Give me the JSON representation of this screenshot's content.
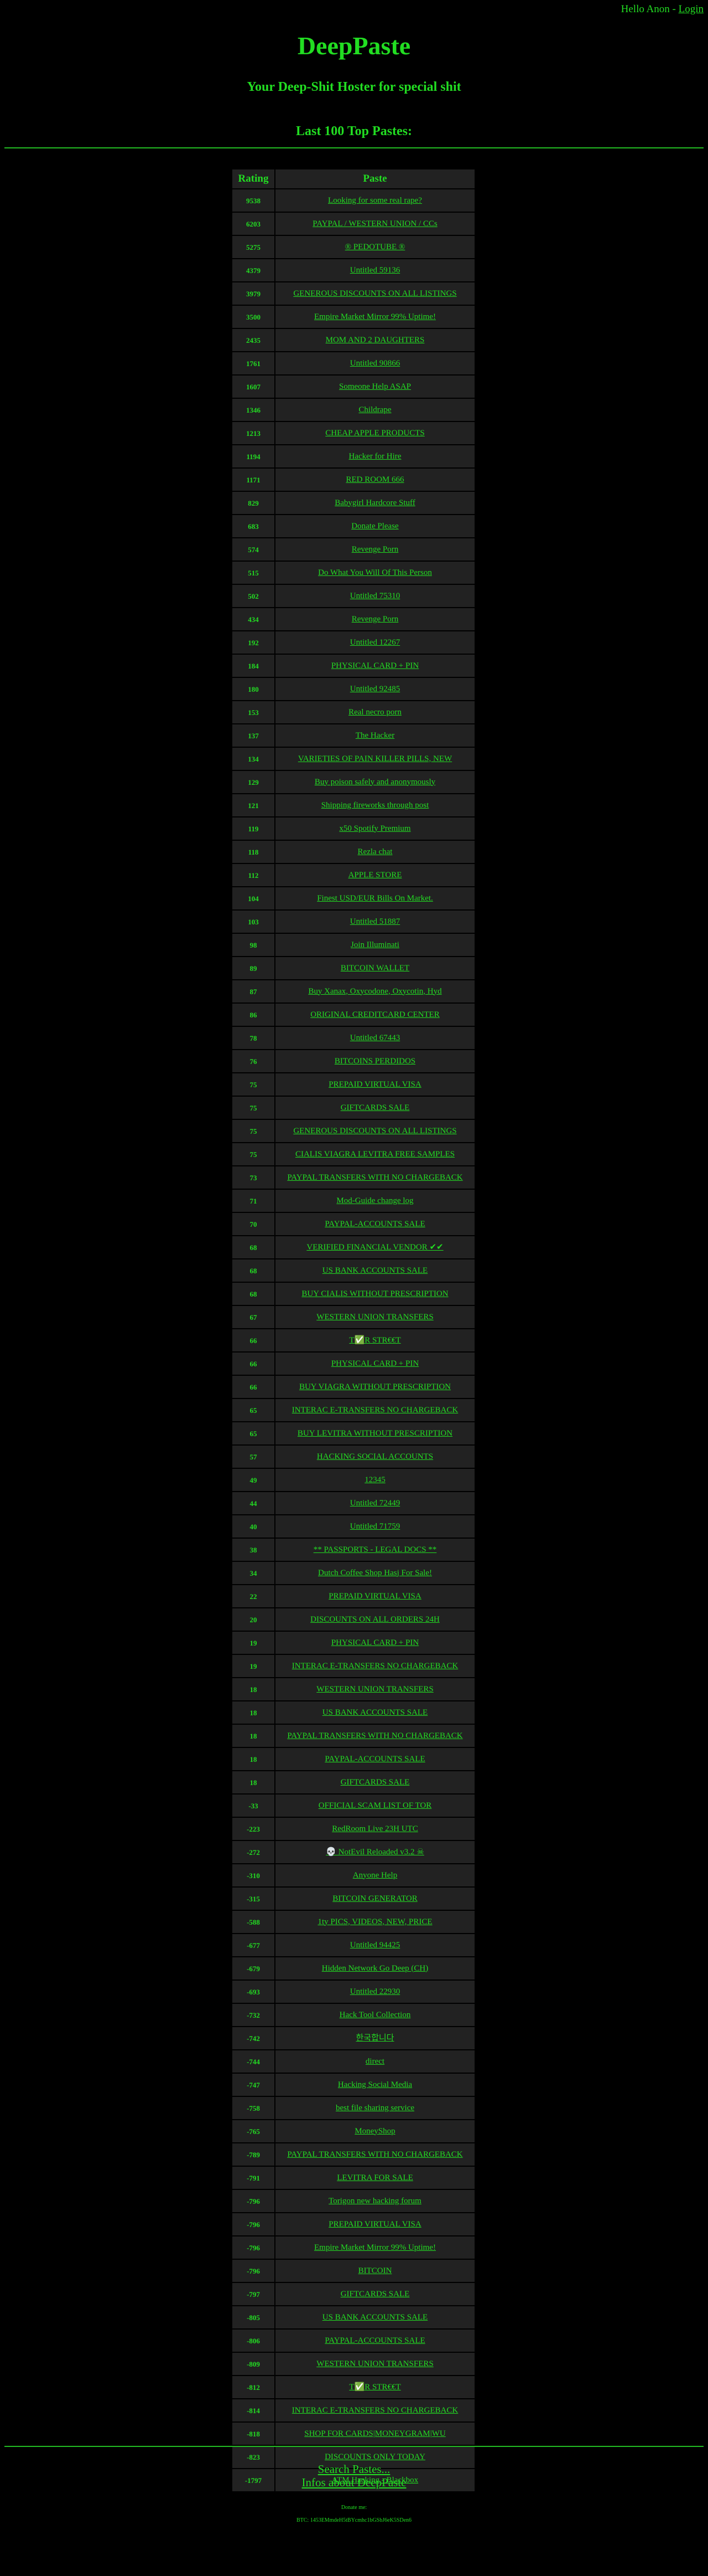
{
  "topbar": {
    "greeting": "Hello Anon -",
    "login": "Login"
  },
  "site": {
    "title": "DeepPaste",
    "tagline": "Your Deep-Shit Hoster for special shit"
  },
  "section_title": "Last 100 Top Pastes:",
  "table": {
    "headers": {
      "rating": "Rating",
      "paste": "Paste"
    },
    "rows": [
      {
        "rating": "9538",
        "title": "Looking for some real rape?"
      },
      {
        "rating": "6203",
        "title": "PAYPAL / WESTERN UNION / CCs"
      },
      {
        "rating": "5275",
        "title": "® PEDOTUBE ®"
      },
      {
        "rating": "4379",
        "title": "Untitled 59136"
      },
      {
        "rating": "3979",
        "title": "GENEROUS DISCOUNTS ON ALL LISTINGS"
      },
      {
        "rating": "3500",
        "title": "Empire Market Mirror 99% Uptime!"
      },
      {
        "rating": "2435",
        "title": "MOM AND 2 DAUGHTERS"
      },
      {
        "rating": "1761",
        "title": "Untitled 90866"
      },
      {
        "rating": "1607",
        "title": "Someone Help ASAP"
      },
      {
        "rating": "1346",
        "title": "Childrape"
      },
      {
        "rating": "1213",
        "title": "CHEAP APPLE PRODUCTS"
      },
      {
        "rating": "1194",
        "title": "Hacker for Hire"
      },
      {
        "rating": "1171",
        "title": "RED ROOM 666"
      },
      {
        "rating": "829",
        "title": "Babygirl Hardcore Stuff"
      },
      {
        "rating": "683",
        "title": "Donate Please"
      },
      {
        "rating": "574",
        "title": "Revenge Porn"
      },
      {
        "rating": "515",
        "title": "Do What You Will Of This Person"
      },
      {
        "rating": "502",
        "title": "Untitled 75310"
      },
      {
        "rating": "434",
        "title": "Revenge Porn"
      },
      {
        "rating": "192",
        "title": "Untitled 12267"
      },
      {
        "rating": "184",
        "title": "PHYSICAL CARD + PIN"
      },
      {
        "rating": "180",
        "title": "Untitled 92485"
      },
      {
        "rating": "153",
        "title": "Real necro porn"
      },
      {
        "rating": "137",
        "title": "The Hacker"
      },
      {
        "rating": "134",
        "title": "VARIETIES OF PAIN KILLER PILLS, NEW"
      },
      {
        "rating": "129",
        "title": "Buy poison safely and anonymously"
      },
      {
        "rating": "121",
        "title": "Shipping fireworks through post"
      },
      {
        "rating": "119",
        "title": "x50 Spotify Premium"
      },
      {
        "rating": "118",
        "title": "Rezla chat"
      },
      {
        "rating": "112",
        "title": "APPLE STORE"
      },
      {
        "rating": "104",
        "title": "Finest USD/EUR Bills On Market."
      },
      {
        "rating": "103",
        "title": "Untitled 51887"
      },
      {
        "rating": "98",
        "title": "Join Illuminati"
      },
      {
        "rating": "89",
        "title": "BITCOIN WALLET"
      },
      {
        "rating": "87",
        "title": "Buy Xanax, Oxycodone, Oxycotin, Hyd"
      },
      {
        "rating": "86",
        "title": "ORIGINAL CREDITCARD CENTER"
      },
      {
        "rating": "78",
        "title": "Untitled 67443"
      },
      {
        "rating": "76",
        "title": "BITCOINS PERDIDOS"
      },
      {
        "rating": "75",
        "title": "PREPAID VIRTUAL VISA"
      },
      {
        "rating": "75",
        "title": "GIFTCARDS SALE"
      },
      {
        "rating": "75",
        "title": "GENEROUS DISCOUNTS ON ALL LISTINGS"
      },
      {
        "rating": "75",
        "title": "CIALIS VIAGRA LEVITRA FREE SAMPLES"
      },
      {
        "rating": "73",
        "title": "PAYPAL TRANSFERS WITH NO CHARGEBACK"
      },
      {
        "rating": "71",
        "title": "Mod-Guide change log"
      },
      {
        "rating": "70",
        "title": "PAYPAL-ACCOUNTS SALE"
      },
      {
        "rating": "68",
        "title": "VERIFIED FINANCIAL VENDOR ✔✔"
      },
      {
        "rating": "68",
        "title": "US BANK ACCOUNTS SALE"
      },
      {
        "rating": "68",
        "title": "BUY CIALIS WITHOUT PRESCRIPTION"
      },
      {
        "rating": "67",
        "title": "WESTERN UNION TRANSFERS"
      },
      {
        "rating": "66",
        "title": "T✅R STR€€T"
      },
      {
        "rating": "66",
        "title": "PHYSICAL CARD + PIN"
      },
      {
        "rating": "66",
        "title": "BUY VIAGRA WITHOUT PRESCRIPTION"
      },
      {
        "rating": "65",
        "title": "INTERAC E-TRANSFERS NO CHARGEBACK"
      },
      {
        "rating": "65",
        "title": "BUY LEVITRA WITHOUT PRESCRIPTION"
      },
      {
        "rating": "57",
        "title": "HACKING SOCIAL ACCOUNTS"
      },
      {
        "rating": "49",
        "title": "12345"
      },
      {
        "rating": "44",
        "title": "Untitled 72449"
      },
      {
        "rating": "40",
        "title": "Untitled 71759"
      },
      {
        "rating": "38",
        "title": "** PASSPORTS - LEGAL DOCS **"
      },
      {
        "rating": "34",
        "title": "Dutch Coffee Shop Hasj For Sale!"
      },
      {
        "rating": "22",
        "title": "PREPAID VIRTUAL VISA"
      },
      {
        "rating": "20",
        "title": "DISCOUNTS ON ALL ORDERS 24H"
      },
      {
        "rating": "19",
        "title": "PHYSICAL CARD + PIN"
      },
      {
        "rating": "19",
        "title": "INTERAC E-TRANSFERS NO CHARGEBACK"
      },
      {
        "rating": "18",
        "title": "WESTERN UNION TRANSFERS"
      },
      {
        "rating": "18",
        "title": "US BANK ACCOUNTS SALE"
      },
      {
        "rating": "18",
        "title": "PAYPAL TRANSFERS WITH NO CHARGEBACK"
      },
      {
        "rating": "18",
        "title": "PAYPAL-ACCOUNTS SALE"
      },
      {
        "rating": "18",
        "title": "GIFTCARDS SALE"
      },
      {
        "rating": "-33",
        "title": "OFFICIAL SCAM LIST OF TOR"
      },
      {
        "rating": "-223",
        "title": "RedRoom Live 23H UTC"
      },
      {
        "rating": "-272",
        "title": "💀 NotEvil Reloaded v3.2 ☠"
      },
      {
        "rating": "-310",
        "title": "Anyone Help"
      },
      {
        "rating": "-315",
        "title": "BITCOIN GENERATOR"
      },
      {
        "rating": "-588",
        "title": "1ty PICS, VIDEOS, NEW, PRICE"
      },
      {
        "rating": "-677",
        "title": "Untitled 94425"
      },
      {
        "rating": "-679",
        "title": "Hidden Network Go Deep (CH)"
      },
      {
        "rating": "-693",
        "title": "Untitled 22930"
      },
      {
        "rating": "-732",
        "title": "Hack Tool Collection"
      },
      {
        "rating": "-742",
        "title": "한국합니다"
      },
      {
        "rating": "-744",
        "title": "direct"
      },
      {
        "rating": "-747",
        "title": "Hacking Social Media"
      },
      {
        "rating": "-758",
        "title": "best file sharing service"
      },
      {
        "rating": "-765",
        "title": "MoneyShop"
      },
      {
        "rating": "-789",
        "title": "PAYPAL TRANSFERS WITH NO CHARGEBACK"
      },
      {
        "rating": "-791",
        "title": "LEVITRA FOR SALE"
      },
      {
        "rating": "-796",
        "title": "Torigon new hacking forum"
      },
      {
        "rating": "-796",
        "title": "PREPAID VIRTUAL VISA"
      },
      {
        "rating": "-796",
        "title": "Empire Market Mirror 99% Uptime!"
      },
      {
        "rating": "-796",
        "title": "BITCOIN"
      },
      {
        "rating": "-797",
        "title": "GIFTCARDS SALE"
      },
      {
        "rating": "-805",
        "title": "US BANK ACCOUNTS SALE"
      },
      {
        "rating": "-806",
        "title": "PAYPAL-ACCOUNTS SALE"
      },
      {
        "rating": "-809",
        "title": "WESTERN UNION TRANSFERS"
      },
      {
        "rating": "-812",
        "title": "T✅R STR€€T"
      },
      {
        "rating": "-814",
        "title": "INTERAC E-TRANSFERS NO CHARGEBACK"
      },
      {
        "rating": "-818",
        "title": "SHOP FOR CARDS|MONEYGRAM|WU"
      },
      {
        "rating": "-823",
        "title": "DISCOUNTS ONLY TODAY"
      },
      {
        "rating": "-1797",
        "title": "ATM Hacking - Blackbox"
      }
    ]
  },
  "footer": {
    "search_link": "Search Pastes...",
    "infos_link": "Infos about DeepPaste",
    "donate_label": "Donate me:",
    "btc_address": "BTC: 1453EMmdeH5tBYcmhc1bGSbJ6eK5SDen6"
  },
  "colors": {
    "background": "#000000",
    "text": "#22dd22",
    "cell": "#222222"
  }
}
